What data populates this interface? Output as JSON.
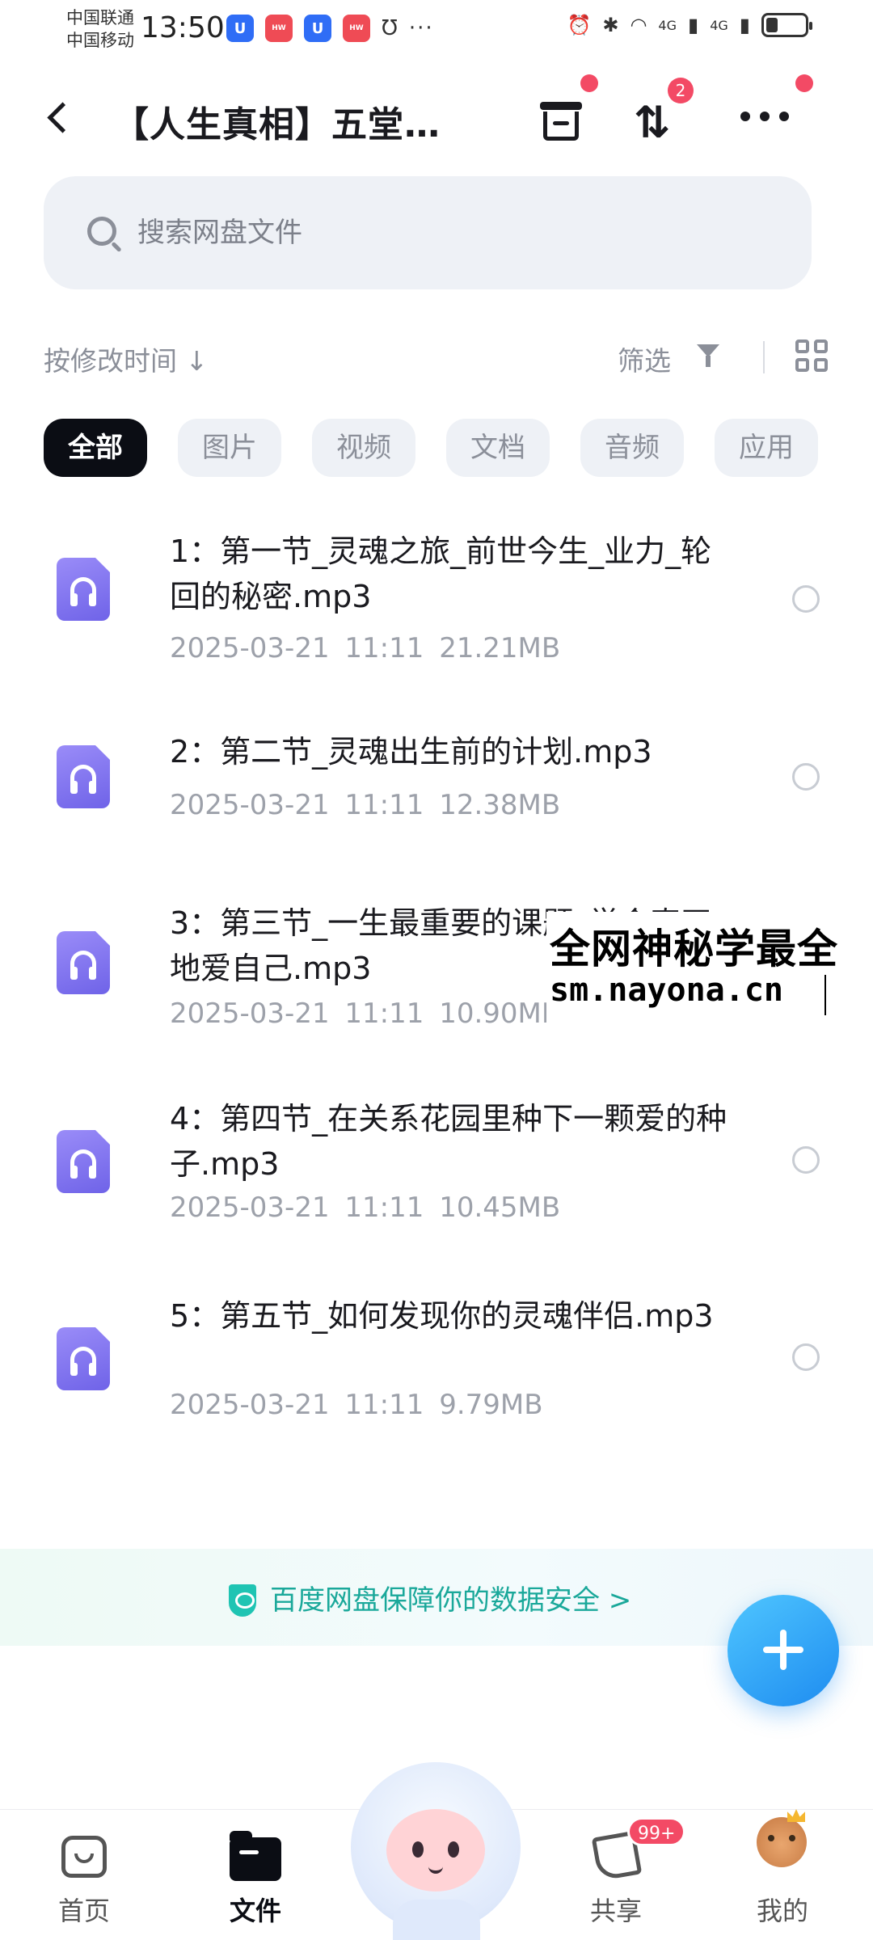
{
  "status_bar": {
    "carrier1": "中国联通",
    "carrier2": "中国移动",
    "time": "13:50",
    "network1": "4G",
    "network2": "4G",
    "icons": [
      "app-u-icon",
      "huawei-icon",
      "app-u-icon",
      "huawei-icon",
      "app-u-icon",
      "alarm-icon",
      "bluetooth-icon",
      "wifi-icon",
      "signal-icon",
      "battery-icon"
    ]
  },
  "header": {
    "title": "【人生真相】五堂…",
    "sort_badge": "2"
  },
  "search": {
    "placeholder": "搜索网盘文件"
  },
  "toolbar": {
    "sort_label": "按修改时间 ↓",
    "filter_label": "筛选"
  },
  "chips": [
    "全部",
    "图片",
    "视频",
    "文档",
    "音频",
    "应用"
  ],
  "files": [
    {
      "name": "1：第一节_灵魂之旅_前世今生_业力_轮回的秘密.mp3",
      "date": "2025-03-21",
      "time": "11:11",
      "size": "21.21MB"
    },
    {
      "name": "2：第二节_灵魂出生前的计划.mp3",
      "date": "2025-03-21",
      "time": "11:11",
      "size": "12.38MB"
    },
    {
      "name": "3：第三节_一生最重要的课题_学会真正地爱自己.mp3",
      "date": "2025-03-21",
      "time": "11:11",
      "size": "10.90MB"
    },
    {
      "name": "4：第四节_在关系花园里种下一颗爱的种子.mp3",
      "date": "2025-03-21",
      "time": "11:11",
      "size": "10.45MB"
    },
    {
      "name": "5：第五节_如何发现你的灵魂伴侣.mp3",
      "date": "2025-03-21",
      "time": "11:11",
      "size": "9.79MB"
    }
  ],
  "watermark": {
    "line1": "全网神秘学最全",
    "line2": "sm.nayona.cn"
  },
  "security_banner": "百度网盘保障你的数据安全 >",
  "bottom_nav": {
    "home": "首页",
    "files": "文件",
    "share": "共享",
    "share_badge": "99+",
    "mine": "我的"
  },
  "colors": {
    "accent": "#1e8cf0",
    "badge": "#f34a65",
    "security_text": "#1aa89a",
    "chip_active": "#0b0d14"
  }
}
